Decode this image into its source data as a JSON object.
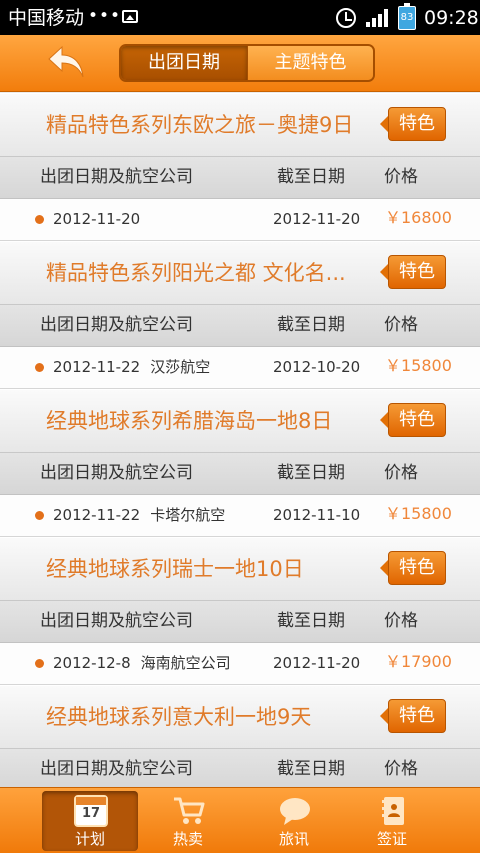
{
  "status_bar": {
    "carrier": "中国移动",
    "dots": "•••",
    "battery_level": "83",
    "time": "09:28"
  },
  "header": {
    "segments": [
      {
        "label": "出团日期",
        "active": true
      },
      {
        "label": "主题特色",
        "active": false
      }
    ]
  },
  "columns": {
    "date_airline": "出团日期及航空公司",
    "deadline": "截至日期",
    "price": "价格"
  },
  "groups": [
    {
      "title": "精品特色系列东欧之旅－奥捷9日",
      "tag": "特色",
      "rows": [
        {
          "date": "2012-11-20",
          "airline": "",
          "deadline": "2012-11-20",
          "price": "￥16800"
        }
      ]
    },
    {
      "title": "精品特色系列阳光之都 文化名...",
      "tag": "特色",
      "rows": [
        {
          "date": "2012-11-22",
          "airline": "汉莎航空",
          "deadline": "2012-10-20",
          "price": "￥15800"
        }
      ]
    },
    {
      "title": "经典地球系列希腊海岛一地8日",
      "tag": "特色",
      "rows": [
        {
          "date": "2012-11-22",
          "airline": "卡塔尔航空",
          "deadline": "2012-11-10",
          "price": "￥15800"
        }
      ]
    },
    {
      "title": "经典地球系列瑞士一地10日",
      "tag": "特色",
      "rows": [
        {
          "date": "2012-12-8",
          "airline": "海南航空公司",
          "deadline": "2012-11-20",
          "price": "￥17900"
        }
      ]
    },
    {
      "title": "经典地球系列意大利一地9天",
      "tag": "特色",
      "rows": []
    }
  ],
  "tabs": [
    {
      "label": "计划",
      "icon": "calendar-icon",
      "icon_text": "17",
      "active": true
    },
    {
      "label": "热卖",
      "icon": "cart-icon",
      "active": false
    },
    {
      "label": "旅讯",
      "icon": "chat-bubble-icon",
      "active": false
    },
    {
      "label": "签证",
      "icon": "visa-book-icon",
      "active": false
    }
  ],
  "colors": {
    "accent": "#f28a1e",
    "title_text": "#e07b2a",
    "price_text": "#f0873a"
  }
}
